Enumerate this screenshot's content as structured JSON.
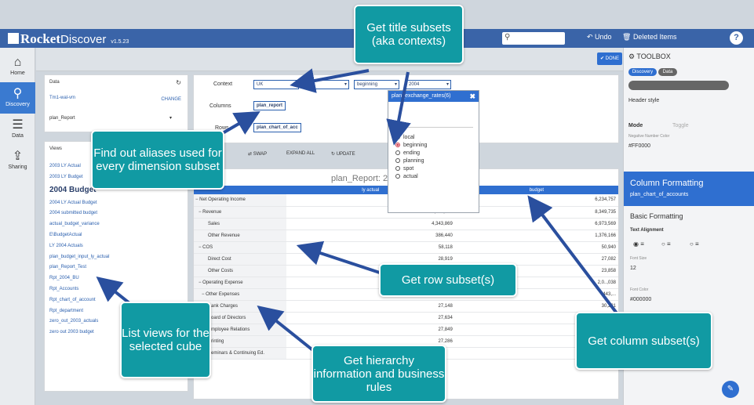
{
  "app": {
    "logo": "Rocket",
    "name": "Discover",
    "version": "v1.5.23"
  },
  "topbar": {
    "undo": "Undo",
    "deleted": "Deleted Items",
    "help": "?"
  },
  "nav": [
    {
      "label": "Home",
      "icon": "home-icon"
    },
    {
      "label": "Discovery",
      "icon": "search-icon"
    },
    {
      "label": "Data",
      "icon": "database-icon"
    },
    {
      "label": "Sharing",
      "icon": "share-icon"
    }
  ],
  "done_label": "DONE",
  "data_panel": {
    "title": "Data",
    "server": "Tm1-wal-vm",
    "change": "CHANGE",
    "report": "plan_Report"
  },
  "views_panel": {
    "title": "Views",
    "items": [
      "2003 LY Actual",
      "2003 LY Budget",
      "2004 Budget",
      "2004 LY Actual Budget",
      "2004 submitted budget",
      "actual_budget_variance",
      "E\\BudgetActual",
      "LY 2004 Actuals",
      "plan_budget_input_ly_actual",
      "plan_Report_Test",
      "Rpt_2004_BU",
      "Rpt_Accounts",
      "Rpt_chart_of_account",
      "Rpt_department",
      "zero_out_2003_actuals",
      "zero out 2003 budget"
    ]
  },
  "context": {
    "label": "Context",
    "values": [
      "UK",
      "...",
      "beginning",
      "2004"
    ],
    "columns_label": "Columns",
    "columns_value": "plan_report",
    "rows_label": "Rows",
    "rows_value": "plan_chart_of_acc"
  },
  "toolrow": {
    "swap": "SWAP",
    "expand": "EXPAND ALL",
    "update": "UPDATE"
  },
  "report": {
    "title": "plan_Report: 2",
    "col1": "ly actual",
    "col2": "budget",
    "rows": [
      {
        "label": "− Net Operating Income",
        "a": "3,883,222",
        "b": "6,234,757"
      },
      {
        "label": "− Revenue",
        "a": "4,730,309",
        "b": "8,349,735"
      },
      {
        "label": "Sales",
        "a": "4,343,869",
        "b": "6,973,569"
      },
      {
        "label": "Other Revenue",
        "a": "386,440",
        "b": "1,376,166"
      },
      {
        "label": "− COS",
        "a": "58,118",
        "b": "50,940"
      },
      {
        "label": "Direct Cost",
        "a": "28,919",
        "b": "27,082"
      },
      {
        "label": "Other Costs",
        "a": "",
        "b": "23,858"
      },
      {
        "label": "− Operating Expense",
        "a": "788,969",
        "b": "2,0..,038"
      },
      {
        "label": "− Other Expenses",
        "a": "449,216",
        "b": "443,..."
      },
      {
        "label": "Bank Charges",
        "a": "27,148",
        "b": "30,231"
      },
      {
        "label": "Board of Directors",
        "a": "27,634",
        "b": ""
      },
      {
        "label": "Employee Relations",
        "a": "27,849",
        "b": ""
      },
      {
        "label": "Printing",
        "a": "27,286",
        "b": ""
      },
      {
        "label": "Seminars & Continuing Ed.",
        "a": "",
        "b": ""
      }
    ]
  },
  "popup": {
    "title": "plan_exchange_rates(6)",
    "close": "✖",
    "options": [
      "local",
      "beginning",
      "ending",
      "planning",
      "spot",
      "actual"
    ],
    "selected": "beginning"
  },
  "toolbox": {
    "title": "TOOLBOX",
    "tabs": [
      "Discovery",
      "Data"
    ],
    "header_style": "Header style",
    "mode_label": "Mode",
    "mode_value": "Toggle",
    "neg_label": "Negative Number Color",
    "neg_value": "#FF0000",
    "colfmt_title": "Column Formatting",
    "colfmt_sub": "plan_chart_of_accounts",
    "basic": "Basic Formatting",
    "text_align": "Text Alignment",
    "font_size_label": "Font Size",
    "font_size_value": "12",
    "font_color_label": "Font Color",
    "font_color_value": "#000000"
  },
  "callouts": {
    "title_subsets": "Get title subsets (aka contexts)",
    "aliases": "Find out aliases used for every dimension subset",
    "row_subsets": "Get row subset(s)",
    "list_views": "List views for the selected cube",
    "hierarchy": "Get hierarchy information and business rules",
    "column_subsets": "Get column subset(s)"
  },
  "colors": {
    "brand": "#3a64a8",
    "accent": "#2f6fd0",
    "callout": "#119aa3",
    "arrow": "#2a4f9e"
  }
}
